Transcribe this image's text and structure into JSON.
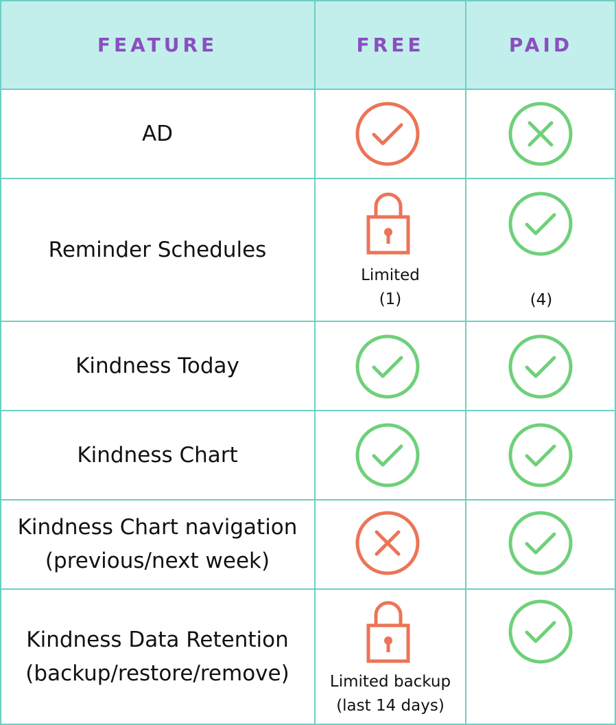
{
  "header": {
    "feature": "FEATURE",
    "free": "FREE",
    "paid": "PAID"
  },
  "colors": {
    "check_green": "#6fd07a",
    "status_orange": "#ec7457",
    "header_bg": "#c2efec",
    "header_text": "#8a4fc0",
    "grid_line": "#6bcfc4"
  },
  "rows": [
    {
      "feature_lines": [
        "AD"
      ],
      "free": {
        "icon": "check-circle-icon"
      },
      "paid": {
        "icon": "x-circle-icon"
      }
    },
    {
      "feature_lines": [
        "Reminder Schedules"
      ],
      "free": {
        "icon": "lock-icon",
        "note_lines": [
          "Limited",
          "(1)"
        ]
      },
      "paid": {
        "icon": "check-circle-icon",
        "note_lines": [
          "(4)"
        ]
      }
    },
    {
      "feature_lines": [
        "Kindness Today"
      ],
      "free": {
        "icon": "check-circle-icon"
      },
      "paid": {
        "icon": "check-circle-icon"
      }
    },
    {
      "feature_lines": [
        "Kindness Chart"
      ],
      "free": {
        "icon": "check-circle-icon"
      },
      "paid": {
        "icon": "check-circle-icon"
      }
    },
    {
      "feature_lines": [
        "Kindness Chart navigation",
        "(previous/next week)"
      ],
      "free": {
        "icon": "x-circle-icon"
      },
      "paid": {
        "icon": "check-circle-icon"
      }
    },
    {
      "feature_lines": [
        "Kindness Data Retention",
        "(backup/restore/remove)"
      ],
      "free": {
        "icon": "lock-icon",
        "note_lines": [
          "Limited backup",
          "(last 14 days)"
        ]
      },
      "paid": {
        "icon": "check-circle-icon"
      }
    }
  ]
}
